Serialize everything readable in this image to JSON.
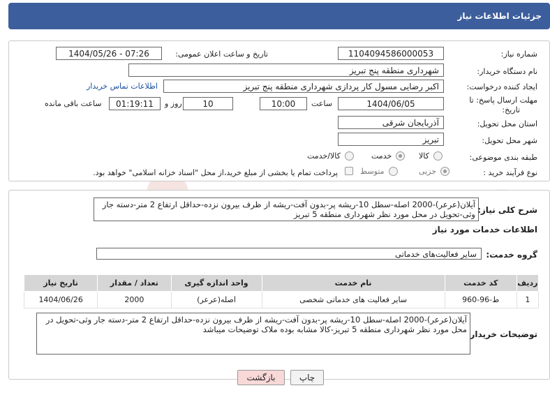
{
  "header": {
    "title": "جزئیات اطلاعات نیاز"
  },
  "form": {
    "need_number_label": "شماره نیاز:",
    "need_number": "1104094586000053",
    "announce_label": "تاریخ و ساعت اعلان عمومی:",
    "announce_value": "1404/05/26 - 07:26",
    "buyer_org_label": "نام دستگاه خریدار:",
    "buyer_org": "شهرداری منطقه پنج تبریز",
    "creator_label": "ایجاد کننده درخواست:",
    "creator": "اکبر رضایی مسول کار پردازی شهرداری منطقه پنج تبریز",
    "contact_link": "اطلاعات تماس خریدار",
    "deadline_label_1": "مهلت ارسال پاسخ: تا",
    "deadline_label_2": "تاریخ:",
    "deadline_date": "1404/06/05",
    "hour_label": "ساعت",
    "deadline_time": "10:00",
    "days_value": "10",
    "day_and_label": "روز و",
    "remaining_time": "01:19:11",
    "remaining_label": "ساعت باقی مانده",
    "province_label": "استان محل تحویل:",
    "province": "آذربایجان شرقی",
    "city_label": "شهر محل تحویل:",
    "city": "تبریز",
    "category_label": "طبقه بندی موضوعی:",
    "category_options": [
      "کالا",
      "خدمت",
      "کالا/خدمت"
    ],
    "category_selected": "خدمت",
    "process_label": "نوع فرآیند خرید :",
    "process_options": [
      "جزیی",
      "متوسط"
    ],
    "process_selected": "جزیی",
    "payment_note": "پرداخت تمام یا بخشی از مبلغ خرید،از محل \"اسناد خزانه اسلامی\" خواهد بود."
  },
  "summary": {
    "label": "شرح کلی نیاز:",
    "text": "آیلان(عرعر)-2000 اصله-سطل 10-ریشه پر-بدون آفت-ریشه از ظرف بیرون نزده-حداقل ارتفاع 2 متر-دسته جار وثی-تحویل در محل مورد نظر شهرداری منطقه 5 تبریز"
  },
  "services": {
    "section_title": "اطلاعات خدمات مورد نیاز",
    "group_label": "گروه خدمت:",
    "group_value": "سایر فعالیت‌های خدماتی",
    "columns": [
      "ردیف",
      "کد خدمت",
      "نام خدمت",
      "واحد اندازه گیری",
      "تعداد / مقدار",
      "تاریخ نیاز"
    ],
    "rows": [
      [
        "1",
        "ط-96-960",
        "سایر فعالیت های خدماتی شخصی",
        "اصله(عرعر)",
        "2000",
        "1404/06/26"
      ]
    ]
  },
  "buyer_notes": {
    "label": "توضیحات خریدار:",
    "text": "آیلان(عرعر)-2000 اصله-سطل 10-ریشه پر-بدون آفت-ریشه از ظرف بیرون نزده-حداقل ارتفاع 2 متر-دسته جار وثی-تحویل در محل مورد نظر شهرداری منطقه 5 تبریز-کالا مشابه بوده ملاک توضیحات میباشد"
  },
  "buttons": {
    "print": "چاپ",
    "back": "بازگشت"
  },
  "colors": {
    "header_bg": "#3c5e9c",
    "back_btn_bg": "#f9d8d8",
    "link": "#1a4fa0"
  }
}
